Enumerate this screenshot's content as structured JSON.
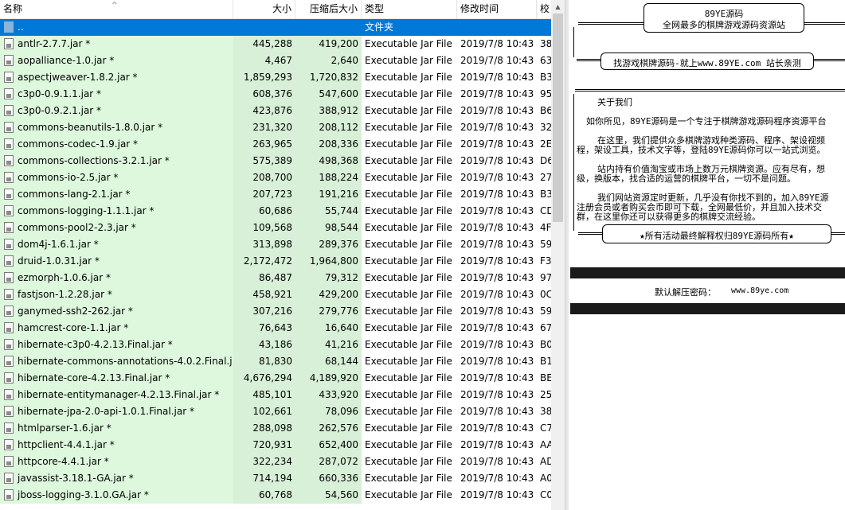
{
  "columns": {
    "name": "名称",
    "size": "大小",
    "packed": "压缩后大小",
    "type": "类型",
    "modified": "修改时间",
    "crc": "校"
  },
  "parent_row": {
    "name": "..",
    "type": "文件夹"
  },
  "files": [
    {
      "name": "antlr-2.7.7.jar *",
      "size": "445,288",
      "packed": "419,200",
      "type": "Executable Jar File",
      "modified": "2019/7/8 10:43",
      "crc": "38"
    },
    {
      "name": "aopalliance-1.0.jar *",
      "size": "4,467",
      "packed": "2,640",
      "type": "Executable Jar File",
      "modified": "2019/7/8 10:43",
      "crc": "63"
    },
    {
      "name": "aspectjweaver-1.8.2.jar *",
      "size": "1,859,293",
      "packed": "1,720,832",
      "type": "Executable Jar File",
      "modified": "2019/7/8 10:43",
      "crc": "B3"
    },
    {
      "name": "c3p0-0.9.1.1.jar *",
      "size": "608,376",
      "packed": "547,600",
      "type": "Executable Jar File",
      "modified": "2019/7/8 10:43",
      "crc": "95"
    },
    {
      "name": "c3p0-0.9.2.1.jar *",
      "size": "423,876",
      "packed": "388,912",
      "type": "Executable Jar File",
      "modified": "2019/7/8 10:43",
      "crc": "B6"
    },
    {
      "name": "commons-beanutils-1.8.0.jar *",
      "size": "231,320",
      "packed": "208,112",
      "type": "Executable Jar File",
      "modified": "2019/7/8 10:43",
      "crc": "32"
    },
    {
      "name": "commons-codec-1.9.jar *",
      "size": "263,965",
      "packed": "208,336",
      "type": "Executable Jar File",
      "modified": "2019/7/8 10:43",
      "crc": "2E"
    },
    {
      "name": "commons-collections-3.2.1.jar *",
      "size": "575,389",
      "packed": "498,368",
      "type": "Executable Jar File",
      "modified": "2019/7/8 10:43",
      "crc": "D6"
    },
    {
      "name": "commons-io-2.5.jar *",
      "size": "208,700",
      "packed": "188,224",
      "type": "Executable Jar File",
      "modified": "2019/7/8 10:43",
      "crc": "27"
    },
    {
      "name": "commons-lang-2.1.jar *",
      "size": "207,723",
      "packed": "191,216",
      "type": "Executable Jar File",
      "modified": "2019/7/8 10:43",
      "crc": "B3"
    },
    {
      "name": "commons-logging-1.1.1.jar *",
      "size": "60,686",
      "packed": "55,744",
      "type": "Executable Jar File",
      "modified": "2019/7/8 10:43",
      "crc": "CD"
    },
    {
      "name": "commons-pool2-2.3.jar *",
      "size": "109,568",
      "packed": "98,544",
      "type": "Executable Jar File",
      "modified": "2019/7/8 10:43",
      "crc": "4F"
    },
    {
      "name": "dom4j-1.6.1.jar *",
      "size": "313,898",
      "packed": "289,376",
      "type": "Executable Jar File",
      "modified": "2019/7/8 10:43",
      "crc": "59"
    },
    {
      "name": "druid-1.0.31.jar *",
      "size": "2,172,472",
      "packed": "1,964,800",
      "type": "Executable Jar File",
      "modified": "2019/7/8 10:43",
      "crc": "F3"
    },
    {
      "name": "ezmorph-1.0.6.jar *",
      "size": "86,487",
      "packed": "79,312",
      "type": "Executable Jar File",
      "modified": "2019/7/8 10:43",
      "crc": "97"
    },
    {
      "name": "fastjson-1.2.28.jar *",
      "size": "458,921",
      "packed": "429,200",
      "type": "Executable Jar File",
      "modified": "2019/7/8 10:43",
      "crc": "0C"
    },
    {
      "name": "ganymed-ssh2-262.jar *",
      "size": "307,216",
      "packed": "279,776",
      "type": "Executable Jar File",
      "modified": "2019/7/8 10:43",
      "crc": "59"
    },
    {
      "name": "hamcrest-core-1.1.jar *",
      "size": "76,643",
      "packed": "16,640",
      "type": "Executable Jar File",
      "modified": "2019/7/8 10:43",
      "crc": "67"
    },
    {
      "name": "hibernate-c3p0-4.2.13.Final.jar *",
      "size": "43,186",
      "packed": "41,216",
      "type": "Executable Jar File",
      "modified": "2019/7/8 10:43",
      "crc": "B0"
    },
    {
      "name": "hibernate-commons-annotations-4.0.2.Final.j...",
      "size": "81,830",
      "packed": "68,144",
      "type": "Executable Jar File",
      "modified": "2019/7/8 10:43",
      "crc": "B1"
    },
    {
      "name": "hibernate-core-4.2.13.Final.jar *",
      "size": "4,676,294",
      "packed": "4,189,920",
      "type": "Executable Jar File",
      "modified": "2019/7/8 10:43",
      "crc": "BE"
    },
    {
      "name": "hibernate-entitymanager-4.2.13.Final.jar *",
      "size": "485,101",
      "packed": "433,920",
      "type": "Executable Jar File",
      "modified": "2019/7/8 10:43",
      "crc": "25"
    },
    {
      "name": "hibernate-jpa-2.0-api-1.0.1.Final.jar *",
      "size": "102,661",
      "packed": "78,096",
      "type": "Executable Jar File",
      "modified": "2019/7/8 10:43",
      "crc": "38"
    },
    {
      "name": "htmlparser-1.6.jar *",
      "size": "288,098",
      "packed": "262,576",
      "type": "Executable Jar File",
      "modified": "2019/7/8 10:43",
      "crc": "C7"
    },
    {
      "name": "httpclient-4.4.1.jar *",
      "size": "720,931",
      "packed": "652,400",
      "type": "Executable Jar File",
      "modified": "2019/7/8 10:43",
      "crc": "AA"
    },
    {
      "name": "httpcore-4.4.1.jar *",
      "size": "322,234",
      "packed": "287,072",
      "type": "Executable Jar File",
      "modified": "2019/7/8 10:43",
      "crc": "AD"
    },
    {
      "name": "javassist-3.18.1-GA.jar *",
      "size": "714,194",
      "packed": "660,336",
      "type": "Executable Jar File",
      "modified": "2019/7/8 10:43",
      "crc": "A0"
    },
    {
      "name": "jboss-logging-3.1.0.GA.jar *",
      "size": "60,768",
      "packed": "54,560",
      "type": "Executable Jar File",
      "modified": "2019/7/8 10:43",
      "crc": "C0"
    }
  ],
  "comment": {
    "banner_title": "89YE源码",
    "banner_sub": "全网最多的棋牌游戏源码资源站",
    "search_line": "找游戏棋牌源码-就上www.89YE.com 站长亲测",
    "about_title": "关于我们",
    "para1_l1": "如你所见，89YE源码是一个专注于棋牌游戏源码程序资源平台",
    "para2_l1": "在这里，我们提供众多棋牌游戏种类源码、程序、架设视频",
    "para2_l2": "程，架设工具，技术文字等，登陆89YE源码你可以一站式浏览。",
    "para3_l1": "站内持有价值淘宝或市场上数万元棋牌资源。应有尽有，想",
    "para3_l2": "级，换版本，找合适的运营的棋牌平台，一切不是问题。",
    "para4_l1": "我们网站资源定时更新，几乎没有你找不到的，加入89YE源",
    "para4_l2": "注册会员或者购买会币即可下载，全网最低价，并且加入技术交",
    "para4_l3": "群，在这里你还可以获得更多的棋牌交流经验。",
    "footer_box": "★所有活动最终解释权归89YE源码所有★",
    "password_label": "默认解压密码：",
    "password_value": "www.89ye.com"
  }
}
